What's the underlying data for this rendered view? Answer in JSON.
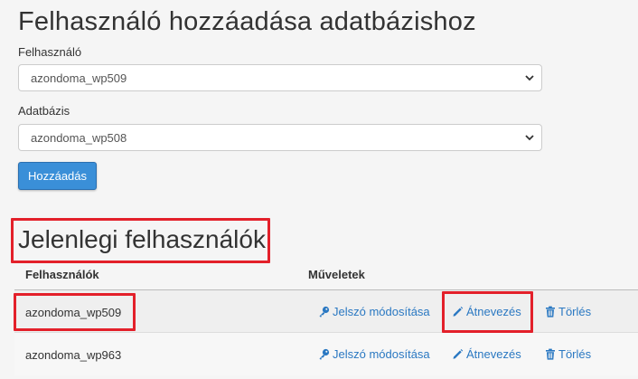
{
  "add_section": {
    "title": "Felhasználó hozzáadása adatbázishoz",
    "user_label": "Felhasználó",
    "user_value": "azondoma_wp509",
    "db_label": "Adatbázis",
    "db_value": "azondoma_wp508",
    "add_button": "Hozzáadás"
  },
  "current_section": {
    "title": "Jelenlegi felhasználók",
    "col_users": "Felhasználók",
    "col_actions": "Műveletek",
    "rows": [
      {
        "user": "azondoma_wp509",
        "pw": "Jelszó módosítása",
        "rename": "Átnevezés",
        "delete": "Törlés"
      },
      {
        "user": "azondoma_wp963",
        "pw": "Jelszó módosítása",
        "rename": "Átnevezés",
        "delete": "Törlés"
      }
    ]
  },
  "colors": {
    "accent": "#3a8fd8",
    "link": "#2a78c2",
    "highlight": "#e3202a"
  },
  "icons": [
    "chevron-down-icon",
    "key-icon",
    "pencil-icon",
    "trash-icon"
  ]
}
